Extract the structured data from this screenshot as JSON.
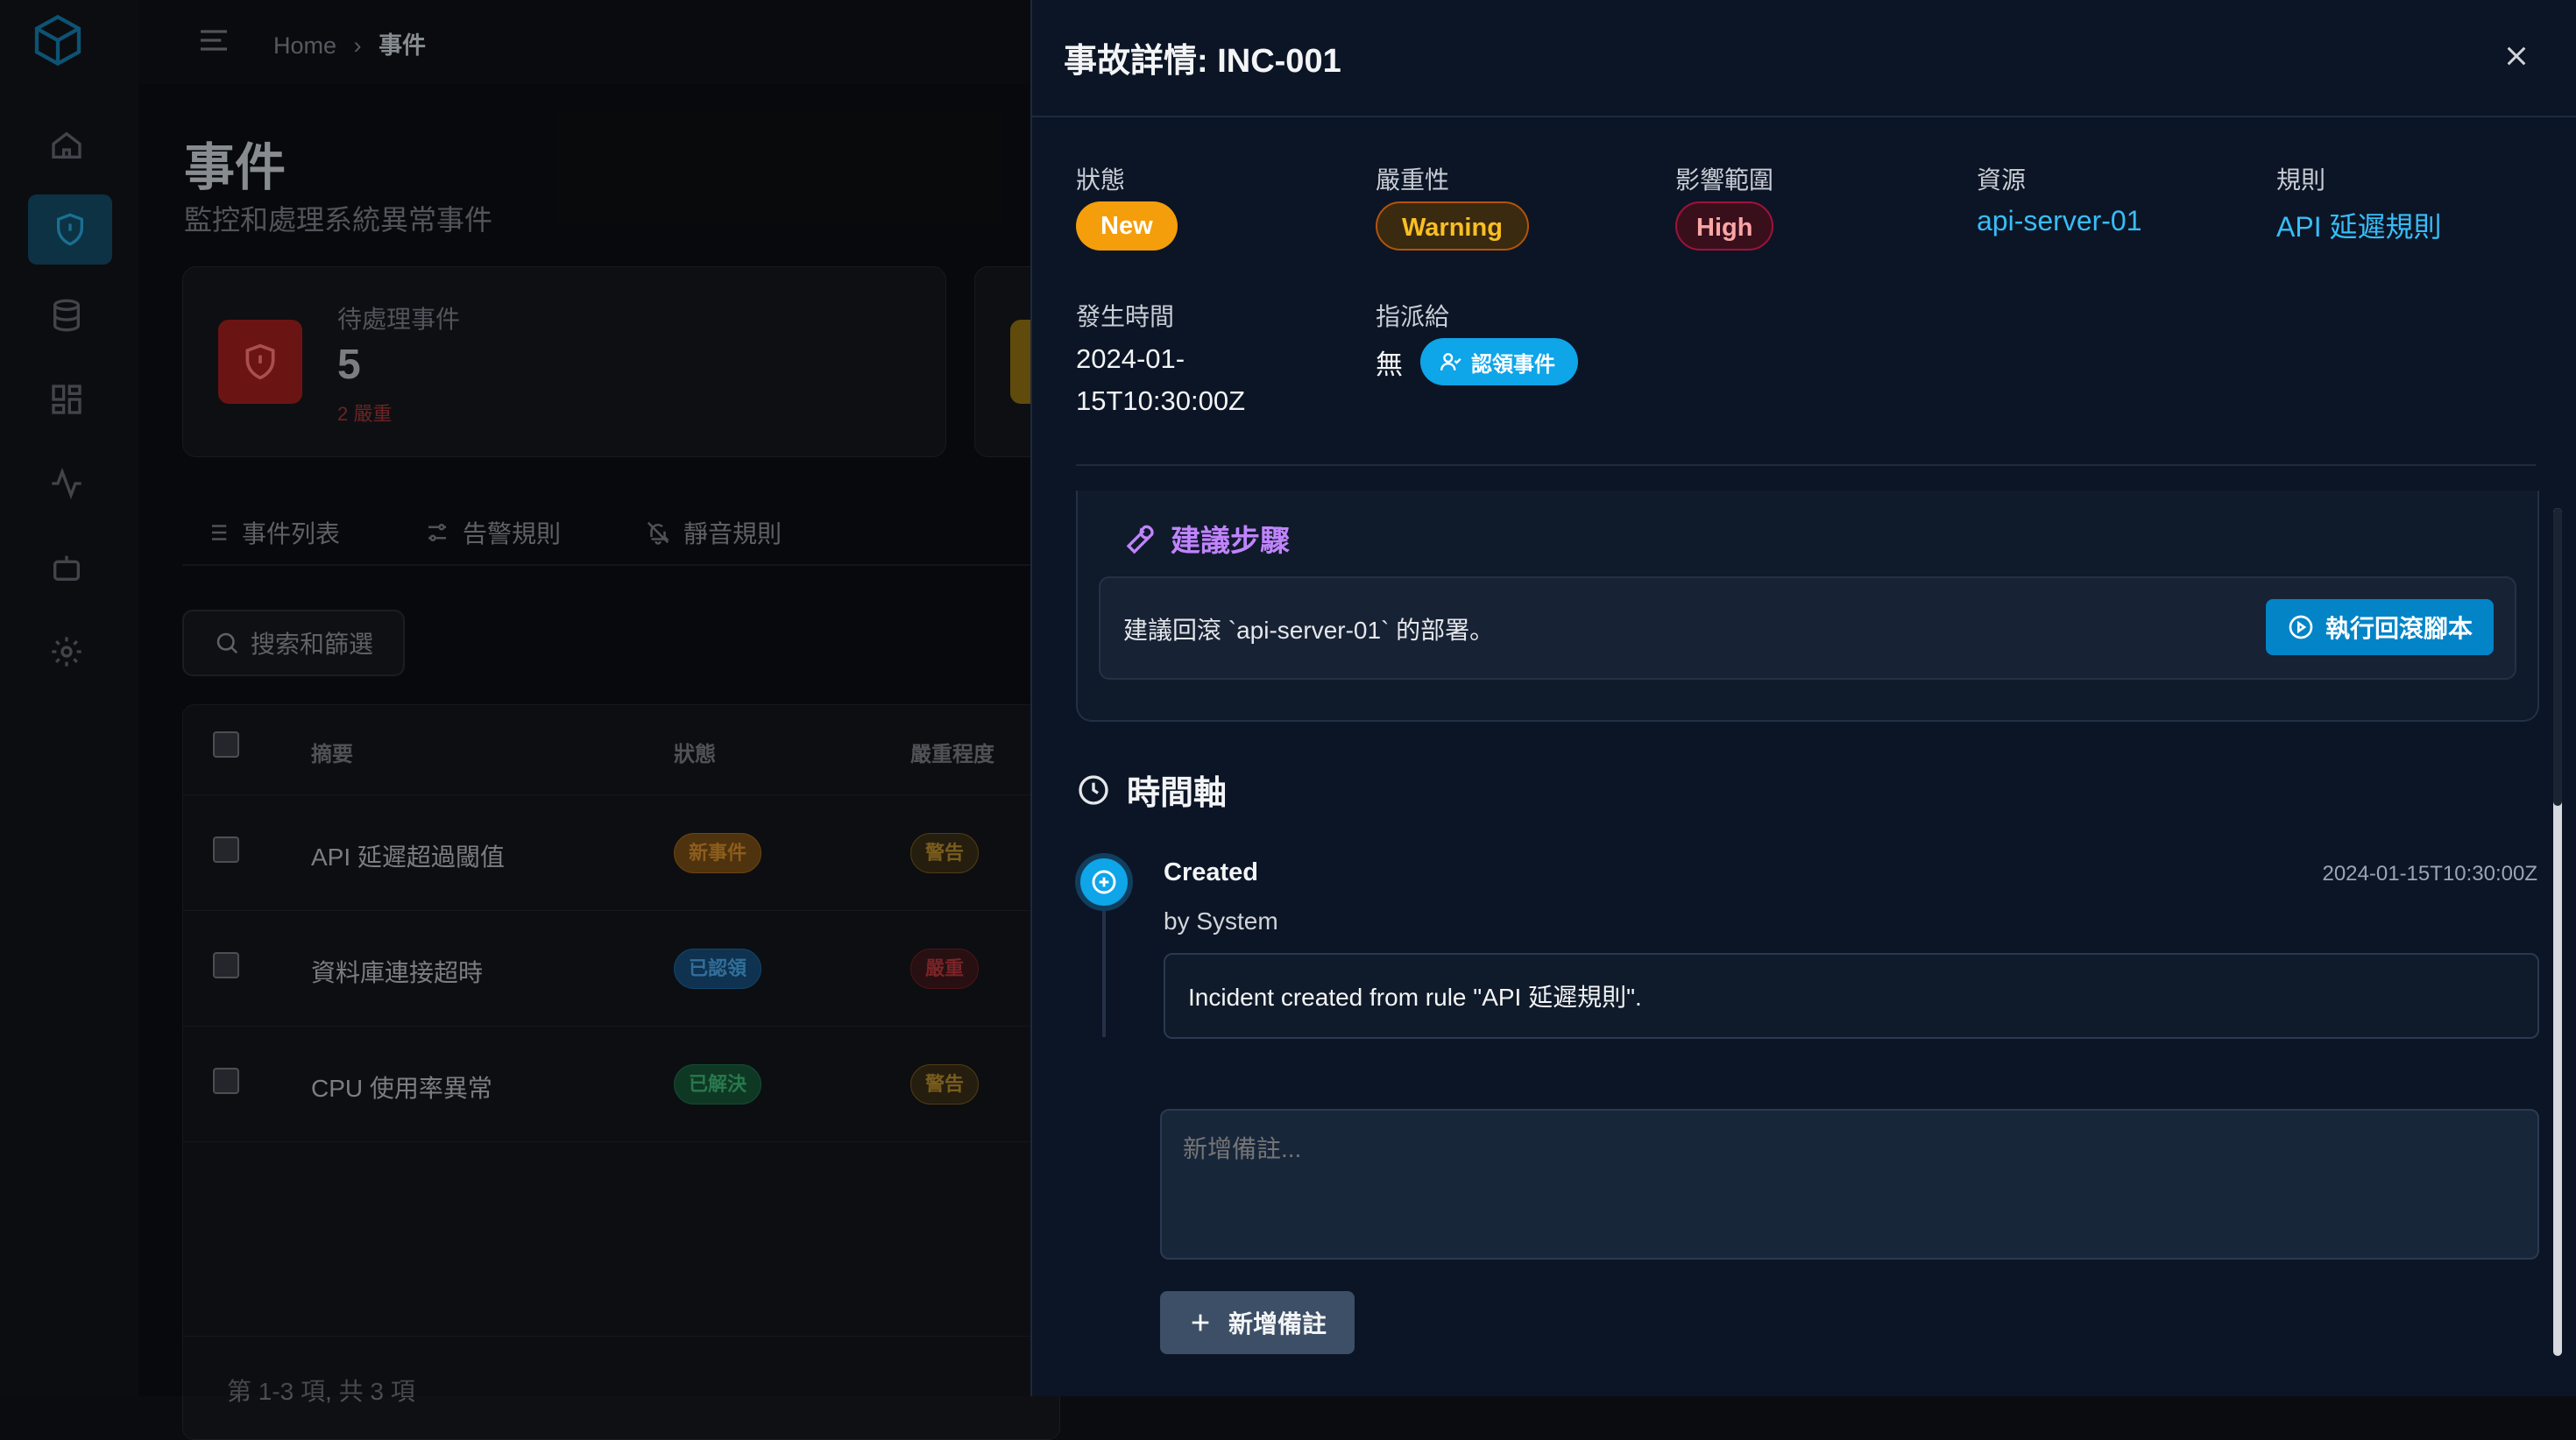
{
  "breadcrumb": {
    "home": "Home",
    "current": "事件"
  },
  "page": {
    "title": "事件",
    "subtitle": "監控和處理系統異常事件"
  },
  "stat": {
    "label": "待處理事件",
    "value": "5",
    "note": "2 嚴重"
  },
  "tabs": [
    {
      "label": "事件列表"
    },
    {
      "label": "告警規則"
    },
    {
      "label": "靜音規則"
    }
  ],
  "search": {
    "label": "搜索和篩選"
  },
  "table": {
    "headers": {
      "summary": "摘要",
      "status": "狀態",
      "severity": "嚴重程度"
    },
    "rows": [
      {
        "summary": "API 延遲超過閾值",
        "status": "新事件",
        "severity": "警告"
      },
      {
        "summary": "資料庫連接超時",
        "status": "已認領",
        "severity": "嚴重"
      },
      {
        "summary": "CPU 使用率異常",
        "status": "已解決",
        "severity": "警告"
      }
    ],
    "footer": "第 1-3 項, 共 3 項"
  },
  "drawer": {
    "title": "事故詳情: INC-001",
    "fields": {
      "status_label": "狀態",
      "status": "New",
      "severity_label": "嚴重性",
      "severity": "Warning",
      "impact_label": "影響範圍",
      "impact": "High",
      "resource_label": "資源",
      "resource": "api-server-01",
      "rule_label": "規則",
      "rule": "API 延遲規則",
      "time_label": "發生時間",
      "time_line1": "2024-01-",
      "time_line2": "15T10:30:00Z",
      "assignee_label": "指派給",
      "assignee": "無",
      "claim_button": "認領事件"
    },
    "suggestion": {
      "title": "建議步驟",
      "text": "建議回滾 `api-server-01` 的部署。",
      "run_button": "執行回滾腳本"
    },
    "timeline": {
      "title": "時間軸",
      "event": {
        "title": "Created",
        "by": "by System",
        "time": "2024-01-15T10:30:00Z",
        "message": "Incident created from rule \"API 延遲規則\"."
      },
      "note_placeholder": "新增備註...",
      "add_note_button": "新增備註"
    }
  },
  "colors": {
    "status_new": "#f59e0b",
    "severity_warning": "#d97706",
    "impact_high": "#e11d48",
    "link": "#38bdf8",
    "accent": "#0ea5e9",
    "suggestion_title": "#c084fc"
  }
}
